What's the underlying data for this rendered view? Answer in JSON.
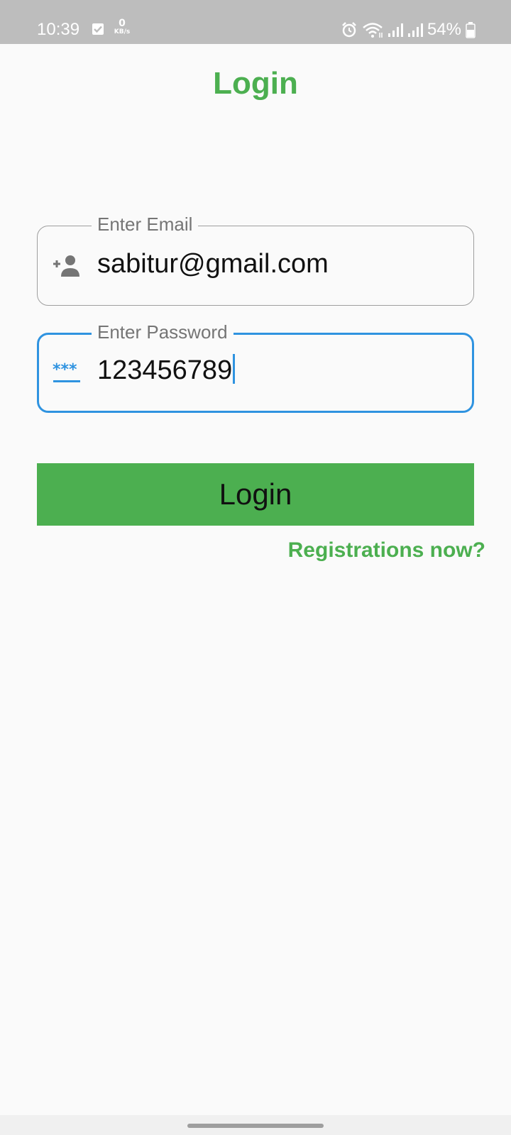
{
  "status_bar": {
    "time": "10:39",
    "speed_value": "0",
    "speed_unit": "KB/s",
    "battery_percent": "54%",
    "icons": [
      "check-box-icon",
      "alarm-icon",
      "wifi-icon",
      "signal-icon",
      "signal-icon",
      "battery-icon"
    ]
  },
  "page": {
    "title": "Login"
  },
  "email_field": {
    "label": "Enter Email",
    "value": "sabitur@gmail.com",
    "icon": "person-add-icon"
  },
  "password_field": {
    "label": "Enter Password",
    "value": "123456789",
    "icon": "password-icon",
    "focused": true
  },
  "login_button": {
    "label": "Login"
  },
  "register_link": {
    "label": "Registrations now?"
  },
  "colors": {
    "accent": "#4caf50",
    "focus": "#2f93e0",
    "status_bar": "#bdbdbd",
    "background": "#fafafa"
  }
}
